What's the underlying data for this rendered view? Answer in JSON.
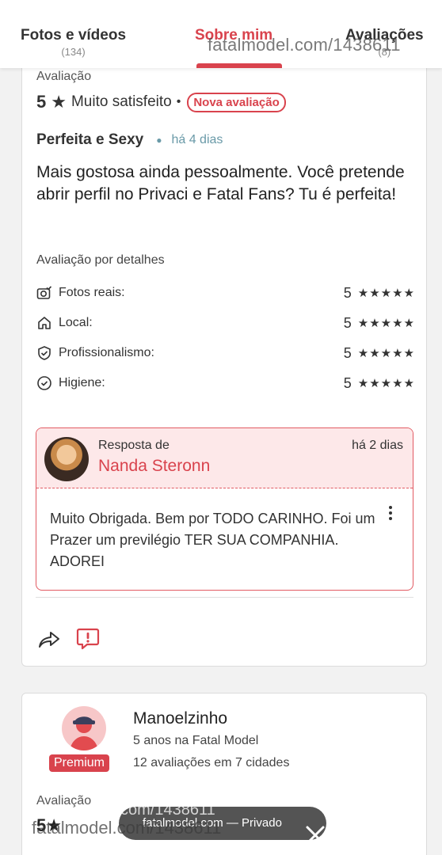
{
  "tabs": {
    "photos": {
      "label": "Fotos e vídeos",
      "count": "(134)"
    },
    "about": {
      "label": "Sobre mim"
    },
    "reviews": {
      "label": "Avaliações",
      "count": "(8)"
    }
  },
  "watermark_top": "fatalmodel.com/1438611",
  "review1": {
    "section_label": "Avaliação",
    "rating": "5",
    "rating_text": "Muito satisfeito",
    "badge": "Nova avaliação",
    "title": "Perfeita e Sexy",
    "time_ago": "há 4 dias",
    "text": "Mais gostosa ainda pessoalmente. Você pretende abrir perfil no Privaci e Fatal Fans? Tu é perfeita!",
    "details_heading": "Avaliação por detalhes",
    "details": [
      {
        "label": "Fotos reais:",
        "value": "5",
        "stars": "★★★★★"
      },
      {
        "label": "Local:",
        "value": "5",
        "stars": "★★★★★"
      },
      {
        "label": "Profissionalismo:",
        "value": "5",
        "stars": "★★★★★"
      },
      {
        "label": "Higiene:",
        "value": "5",
        "stars": "★★★★★"
      }
    ],
    "reply": {
      "from_label": "Resposta de",
      "author": "Nanda Steronn",
      "time_ago": "há 2 dias",
      "text": "Muito Obrigada. Bem por TODO CARINHO. Foi um Prazer um previlégio TER SUA COMPANHIA. ADOREI"
    }
  },
  "review2": {
    "badge": "Premium",
    "name": "Manoelzinho",
    "years": "5 anos na Fatal Model",
    "reviews": "12 avaliações em 7 cidades",
    "section_label": "Avaliação",
    "rating": "5★"
  },
  "toast": {
    "text": "fatalmodel.com — Privado"
  },
  "watermark_bottom_1": "com/1438611",
  "watermark_bottom_2": "fatalmodel.com/1438611",
  "colors": {
    "accent": "#d9434d",
    "accent_light": "#fde8e9"
  },
  "icons": [
    "camera-check-icon",
    "home-icon",
    "shield-check-icon",
    "check-circle-icon",
    "share-icon",
    "report-icon",
    "more-vertical-icon",
    "close-icon",
    "star-icon"
  ]
}
